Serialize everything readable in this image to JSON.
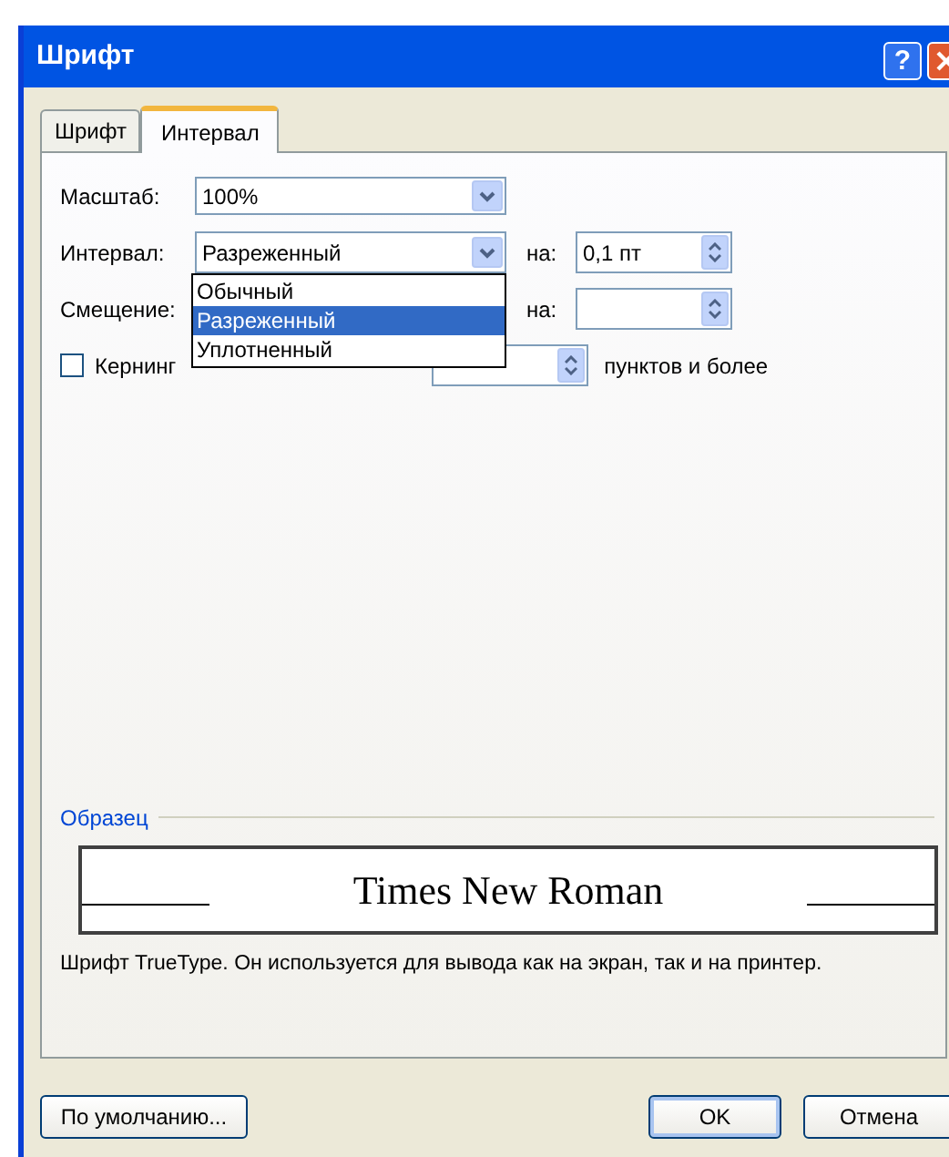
{
  "window": {
    "title": "Шрифт"
  },
  "help_button": {
    "label": "?"
  },
  "tabs": [
    {
      "label": "Шрифт",
      "selected": false
    },
    {
      "label": "Интервал",
      "selected": true
    }
  ],
  "scale": {
    "label": "Масштаб:",
    "value": "100%"
  },
  "spacing": {
    "label": "Интервал:",
    "value": "Разреженный",
    "by_label": "на:",
    "by_value": "0,1 пт",
    "dropdown": {
      "open": true,
      "options": [
        {
          "label": "Обычный",
          "selected": false
        },
        {
          "label": "Разреженный",
          "selected": true
        },
        {
          "label": "Уплотненный",
          "selected": false
        }
      ]
    }
  },
  "position": {
    "label": "Смещение:",
    "by_label": "на:"
  },
  "kerning": {
    "label": "Кернинг",
    "checked": false,
    "suffix": "пунктов и более"
  },
  "preview": {
    "label": "Образец",
    "sample": "Times New Roman",
    "description": "Шрифт TrueType. Он используется для вывода как на экран, так и на принтер."
  },
  "buttons": [
    {
      "label": "По умолчанию...",
      "kind": "default"
    },
    {
      "label": "OK",
      "kind": "ok"
    },
    {
      "label": "Отмена",
      "kind": "cancel"
    }
  ]
}
